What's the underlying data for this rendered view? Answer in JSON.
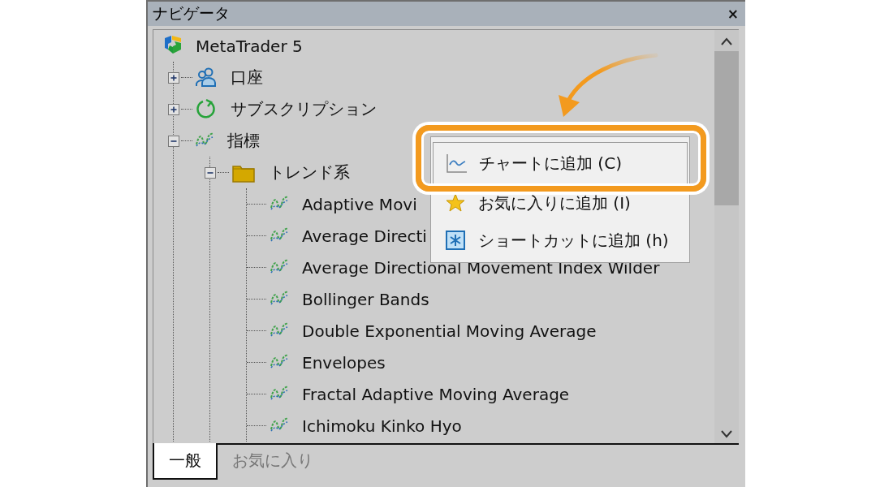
{
  "window": {
    "title": "ナビゲータ",
    "close": "×"
  },
  "tree": [
    {
      "label": "MetaTrader 5",
      "kind": "logo",
      "children": [
        {
          "label": "口座",
          "kind": "account",
          "expanded": false
        },
        {
          "label": "サブスクリプション",
          "kind": "subscription",
          "expanded": false
        },
        {
          "label": "指標",
          "kind": "indicator",
          "expanded": true,
          "children": [
            {
              "label": "トレンド系",
              "kind": "folder",
              "expanded": true,
              "children": [
                {
                  "label": "Adaptive Movi",
                  "kind": "indicator"
                },
                {
                  "label": "Average Directi",
                  "kind": "indicator"
                },
                {
                  "label": "Average Directional Movement Index Wilder",
                  "kind": "indicator"
                },
                {
                  "label": "Bollinger Bands",
                  "kind": "indicator"
                },
                {
                  "label": "Double Exponential Moving Average",
                  "kind": "indicator"
                },
                {
                  "label": "Envelopes",
                  "kind": "indicator"
                },
                {
                  "label": "Fractal Adaptive Moving Average",
                  "kind": "indicator"
                },
                {
                  "label": "Ichimoku Kinko Hyo",
                  "kind": "indicator"
                }
              ]
            }
          ]
        }
      ]
    }
  ],
  "context_menu": {
    "items": [
      {
        "label": "チャートに追加 (C)",
        "kind": "chart",
        "highlighted": true
      },
      {
        "label": "お気に入りに追加 (I)",
        "kind": "favorite",
        "highlighted": false
      },
      {
        "label": "ショートカットに追加 (h)",
        "kind": "shortcut",
        "highlighted": false
      }
    ]
  },
  "tabs": [
    {
      "label": "一般",
      "selected": true
    },
    {
      "label": "お気に入り",
      "selected": false
    }
  ]
}
